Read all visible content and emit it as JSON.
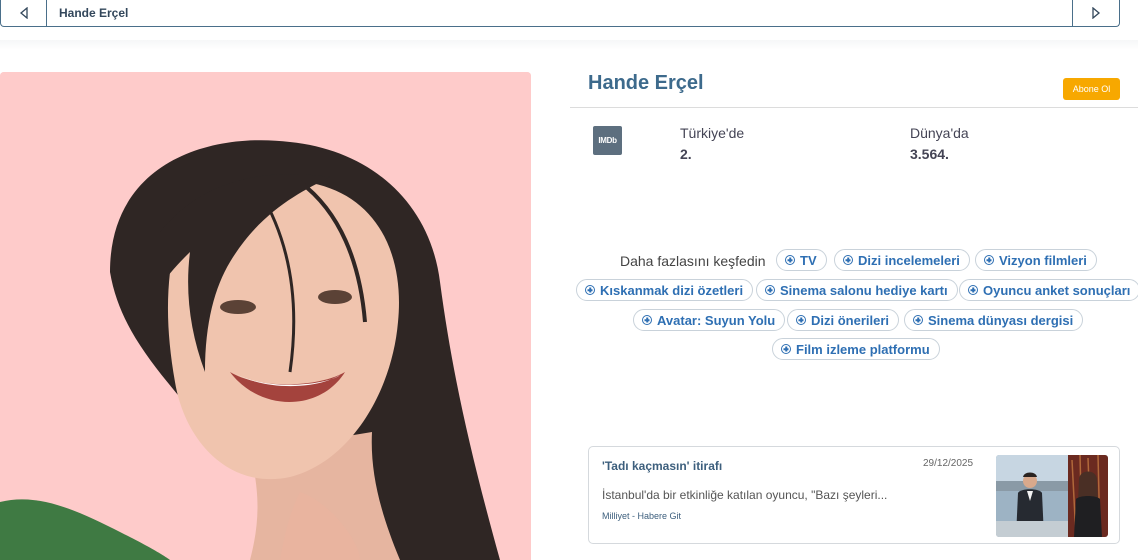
{
  "topbar": {
    "title": "Hande Erçel",
    "prev_icon": "triangle-left-icon",
    "next_icon": "triangle-right-icon"
  },
  "profile": {
    "name": "Hande Erçel",
    "subscribe_label": "Abone Ol",
    "subscribe_color": "#f7a800"
  },
  "ranking": {
    "icon_text": "IMDb",
    "turkey_label": "Türkiye'de",
    "turkey_value": "2.",
    "world_label": "Dünya'da",
    "world_value": "3.564."
  },
  "explore": {
    "label": "Daha fazlasını keşfedin",
    "chips": [
      "TV",
      "Dizi incelemeleri",
      "Vizyon filmleri",
      "Kıskanmak dizi özetleri",
      "Sinema salonu hediye kartı",
      "Oyuncu anket sonuçları",
      "Avatar: Suyun Yolu",
      "Dizi önerileri",
      "Sinema dünyası dergisi",
      "Film izleme platformu"
    ]
  },
  "news": {
    "title": "'Tadı kaçmasın' itirafı",
    "date": "29/12/2025",
    "excerpt": "İstanbul'da bir etkinliğe katılan oyuncu, \"Bazı şeyleri...",
    "source": "Milliyet - Habere Git"
  },
  "colors": {
    "accent": "#3d6a8c",
    "chip_text": "#2e6fb3",
    "photo_background": "#fecbca"
  }
}
